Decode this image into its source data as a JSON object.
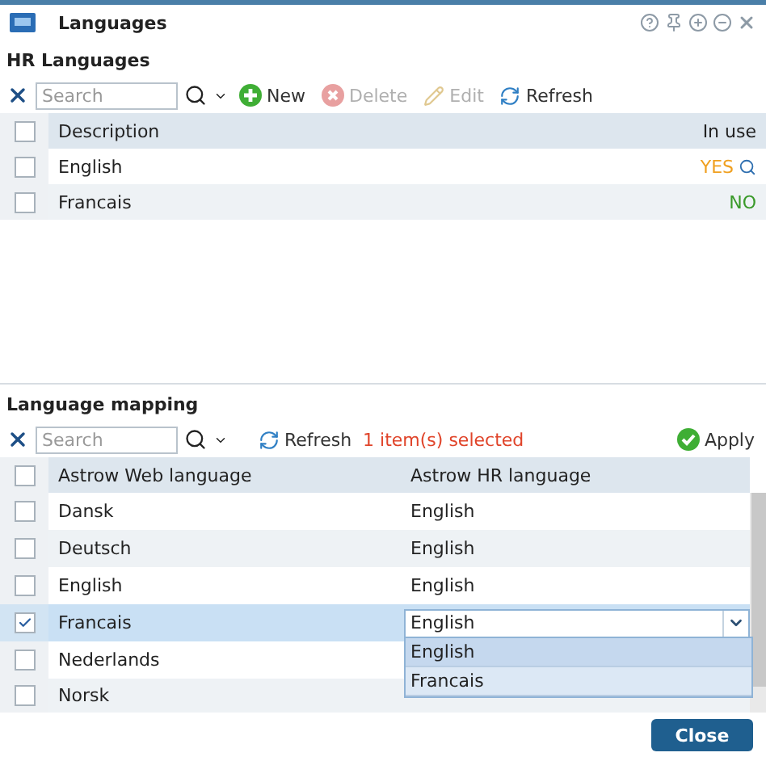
{
  "window": {
    "title": "Languages"
  },
  "hr_languages": {
    "title": "HR Languages",
    "search": {
      "placeholder": "Search"
    },
    "toolbar": [
      {
        "label": "New",
        "kind": "new",
        "disabled": false
      },
      {
        "label": "Delete",
        "kind": "delete",
        "disabled": true
      },
      {
        "label": "Edit",
        "kind": "edit",
        "disabled": true
      },
      {
        "label": "Refresh",
        "kind": "refresh",
        "disabled": false
      }
    ],
    "columns": [
      "Description",
      "In use"
    ],
    "header_checked": false,
    "rows": [
      {
        "description": "English",
        "in_use": "YES",
        "kind": "yes",
        "checked": false
      },
      {
        "description": "Francais",
        "in_use": "NO",
        "kind": "no",
        "checked": false
      }
    ]
  },
  "language_mapping": {
    "title": "Language mapping",
    "search": {
      "placeholder": "Search"
    },
    "refresh": "Refresh",
    "selection_count": "1 item(s) selected",
    "apply": "Apply",
    "columns": [
      "Astrow Web language",
      "Astrow HR language"
    ],
    "header_checked": false,
    "rows": [
      {
        "web": "Dansk",
        "hr": "English",
        "checked": false,
        "editing": false
      },
      {
        "web": "Deutsch",
        "hr": "English",
        "checked": false,
        "editing": false
      },
      {
        "web": "English",
        "hr": "English",
        "checked": false,
        "editing": false
      },
      {
        "web": "Francais",
        "hr": "English",
        "checked": true,
        "editing": true,
        "options": [
          {
            "label": "English",
            "selected": true
          },
          {
            "label": "Francais",
            "selected": false
          }
        ]
      },
      {
        "web": "Nederlands",
        "checked": false,
        "editing": false
      },
      {
        "web": "Norsk",
        "checked": false,
        "editing": false
      }
    ]
  },
  "close": "Close"
}
